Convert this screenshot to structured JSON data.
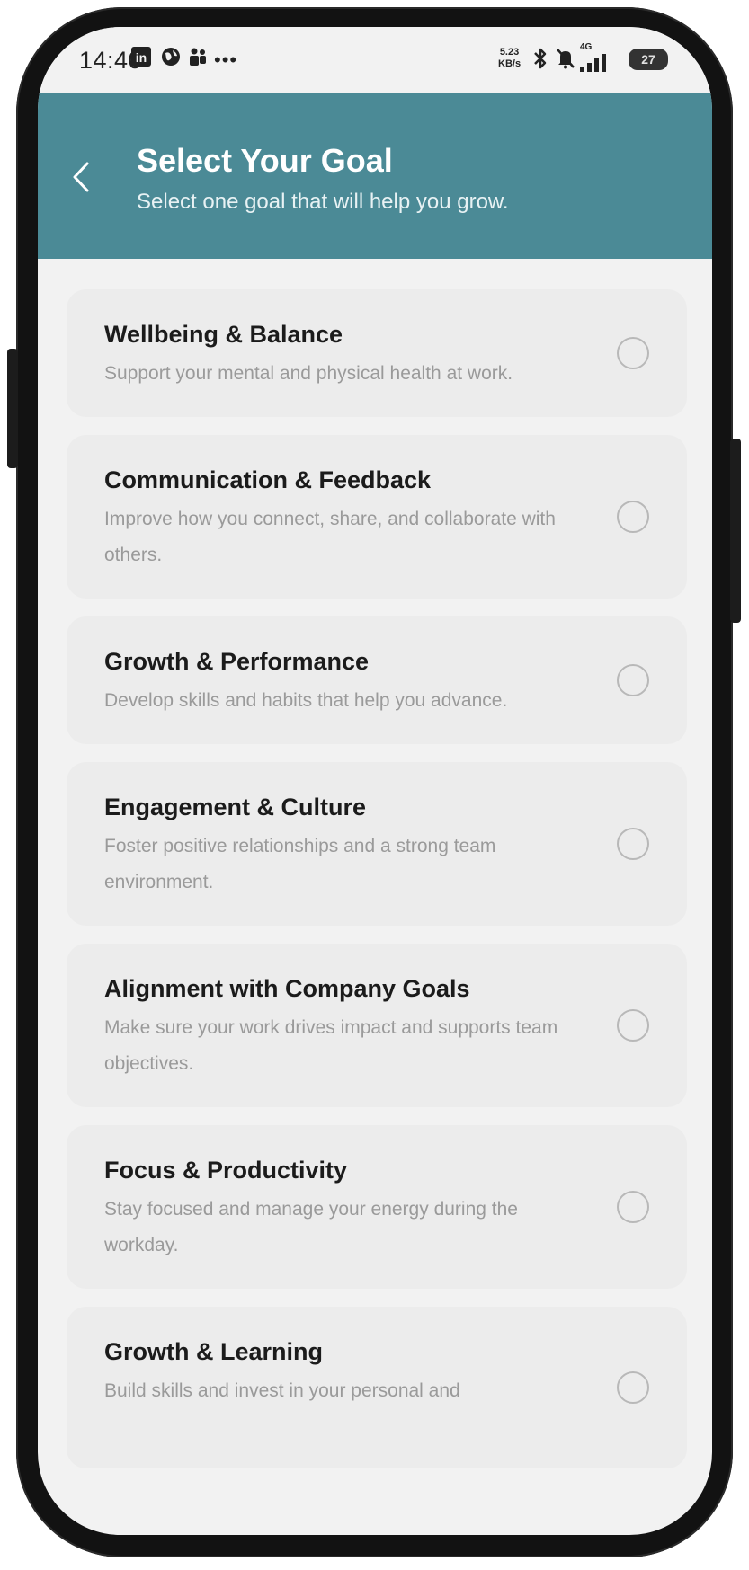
{
  "status_bar": {
    "time": "14:40",
    "speed_value": "5.23",
    "speed_unit": "KB/s",
    "network_type": "4G",
    "battery_level": "27",
    "icons": [
      "linkedin-icon",
      "globe-icon",
      "teams-icon",
      "more-dots-icon",
      "bluetooth-icon",
      "mute-icon",
      "signal-icon",
      "battery-icon"
    ]
  },
  "header": {
    "title": "Select Your Goal",
    "subtitle": "Select one goal that will help you grow.",
    "background_color": "#4b8a96"
  },
  "goals": [
    {
      "title": "Wellbeing & Balance",
      "description": "Support your mental and physical health at work."
    },
    {
      "title": "Communication & Feedback",
      "description": "Improve how you connect, share, and collaborate with others."
    },
    {
      "title": "Growth & Performance",
      "description": "Develop skills and habits that help you advance."
    },
    {
      "title": "Engagement & Culture",
      "description": "Foster positive relationships and a strong team environment."
    },
    {
      "title": "Alignment with Company Goals",
      "description": "Make sure your work drives impact and supports team objectives."
    },
    {
      "title": "Focus & Productivity",
      "description": "Stay focused and manage your energy during the workday."
    },
    {
      "title": "Growth & Learning",
      "description": "Build skills and invest in your personal and"
    }
  ]
}
